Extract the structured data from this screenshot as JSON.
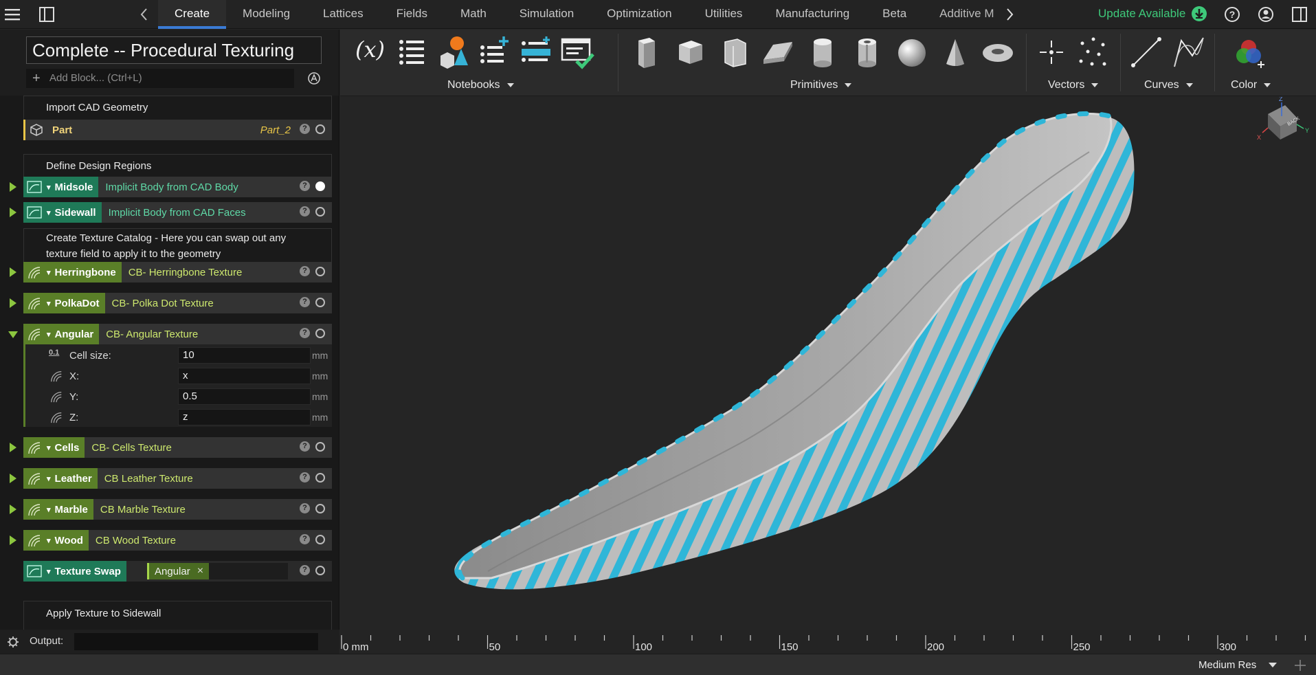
{
  "topnav": {
    "tabs": [
      "Create",
      "Modeling",
      "Lattices",
      "Fields",
      "Math",
      "Simulation",
      "Optimization",
      "Utilities",
      "Manufacturing",
      "Beta",
      "Additive M"
    ],
    "active_tab": "Create",
    "update_label": "Update Available",
    "accent_color": "#3ec97a"
  },
  "notebook": {
    "title": "Complete -- Procedural Texturing",
    "add_block_placeholder": "Add Block... (Ctrl+L)"
  },
  "blocks": {
    "c1": "Import CAD Geometry",
    "part": {
      "name": "Part",
      "value": "Part_2"
    },
    "c2": "Define Design Regions",
    "midsole": {
      "name": "Midsole",
      "type": "Implicit Body from CAD Body"
    },
    "sidewall": {
      "name": "Sidewall",
      "type": "Implicit Body from CAD Faces"
    },
    "c3": "Create Texture Catalog - Here you can swap out any texture field to apply it to the geometry",
    "herringbone": {
      "name": "Herringbone",
      "type": "CB- Herringbone Texture"
    },
    "polkadot": {
      "name": "PolkaDot",
      "type": "CB- Polka Dot Texture"
    },
    "angular": {
      "name": "Angular",
      "type": "CB- Angular Texture",
      "params": [
        {
          "label": "Cell size:",
          "value": "10",
          "unit": "mm",
          "icon": "0.1"
        },
        {
          "label": "X:",
          "value": "x",
          "unit": "mm"
        },
        {
          "label": "Y:",
          "value": "0.5",
          "unit": "mm"
        },
        {
          "label": "Z:",
          "value": "z",
          "unit": "mm"
        }
      ]
    },
    "cells": {
      "name": "Cells",
      "type": "CB- Cells Texture"
    },
    "leather": {
      "name": "Leather",
      "type": "CB Leather Texture"
    },
    "marble": {
      "name": "Marble",
      "type": "CB Marble Texture"
    },
    "wood": {
      "name": "Wood",
      "type": "CB Wood Texture"
    },
    "swap": {
      "name": "Texture Swap",
      "chip": "Angular",
      "chip_close": "×"
    },
    "c4": "Apply Texture to Sidewall"
  },
  "ribbon": {
    "notebooks_label": "Notebooks",
    "primitives_label": "Primitives",
    "vectors_label": "Vectors",
    "curves_label": "Curves",
    "color_label": "Color",
    "var_label": "(x)"
  },
  "viewcube": {
    "face": "BACK",
    "x": "X",
    "y": "Y",
    "z": "Z"
  },
  "ruler": {
    "ticks": [
      "0 mm",
      "50",
      "100",
      "150",
      "200",
      "250",
      "300"
    ]
  },
  "output": {
    "label": "Output:"
  },
  "status": {
    "resolution": "Medium Res"
  }
}
